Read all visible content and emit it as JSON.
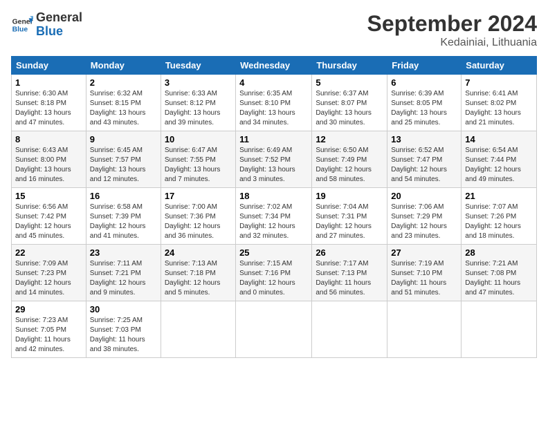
{
  "logo": {
    "line1": "General",
    "line2": "Blue"
  },
  "title": "September 2024",
  "location": "Kedainiai, Lithuania",
  "headers": [
    "Sunday",
    "Monday",
    "Tuesday",
    "Wednesday",
    "Thursday",
    "Friday",
    "Saturday"
  ],
  "weeks": [
    [
      {
        "day": "1",
        "detail": "Sunrise: 6:30 AM\nSunset: 8:18 PM\nDaylight: 13 hours\nand 47 minutes."
      },
      {
        "day": "2",
        "detail": "Sunrise: 6:32 AM\nSunset: 8:15 PM\nDaylight: 13 hours\nand 43 minutes."
      },
      {
        "day": "3",
        "detail": "Sunrise: 6:33 AM\nSunset: 8:12 PM\nDaylight: 13 hours\nand 39 minutes."
      },
      {
        "day": "4",
        "detail": "Sunrise: 6:35 AM\nSunset: 8:10 PM\nDaylight: 13 hours\nand 34 minutes."
      },
      {
        "day": "5",
        "detail": "Sunrise: 6:37 AM\nSunset: 8:07 PM\nDaylight: 13 hours\nand 30 minutes."
      },
      {
        "day": "6",
        "detail": "Sunrise: 6:39 AM\nSunset: 8:05 PM\nDaylight: 13 hours\nand 25 minutes."
      },
      {
        "day": "7",
        "detail": "Sunrise: 6:41 AM\nSunset: 8:02 PM\nDaylight: 13 hours\nand 21 minutes."
      }
    ],
    [
      {
        "day": "8",
        "detail": "Sunrise: 6:43 AM\nSunset: 8:00 PM\nDaylight: 13 hours\nand 16 minutes."
      },
      {
        "day": "9",
        "detail": "Sunrise: 6:45 AM\nSunset: 7:57 PM\nDaylight: 13 hours\nand 12 minutes."
      },
      {
        "day": "10",
        "detail": "Sunrise: 6:47 AM\nSunset: 7:55 PM\nDaylight: 13 hours\nand 7 minutes."
      },
      {
        "day": "11",
        "detail": "Sunrise: 6:49 AM\nSunset: 7:52 PM\nDaylight: 13 hours\nand 3 minutes."
      },
      {
        "day": "12",
        "detail": "Sunrise: 6:50 AM\nSunset: 7:49 PM\nDaylight: 12 hours\nand 58 minutes."
      },
      {
        "day": "13",
        "detail": "Sunrise: 6:52 AM\nSunset: 7:47 PM\nDaylight: 12 hours\nand 54 minutes."
      },
      {
        "day": "14",
        "detail": "Sunrise: 6:54 AM\nSunset: 7:44 PM\nDaylight: 12 hours\nand 49 minutes."
      }
    ],
    [
      {
        "day": "15",
        "detail": "Sunrise: 6:56 AM\nSunset: 7:42 PM\nDaylight: 12 hours\nand 45 minutes."
      },
      {
        "day": "16",
        "detail": "Sunrise: 6:58 AM\nSunset: 7:39 PM\nDaylight: 12 hours\nand 41 minutes."
      },
      {
        "day": "17",
        "detail": "Sunrise: 7:00 AM\nSunset: 7:36 PM\nDaylight: 12 hours\nand 36 minutes."
      },
      {
        "day": "18",
        "detail": "Sunrise: 7:02 AM\nSunset: 7:34 PM\nDaylight: 12 hours\nand 32 minutes."
      },
      {
        "day": "19",
        "detail": "Sunrise: 7:04 AM\nSunset: 7:31 PM\nDaylight: 12 hours\nand 27 minutes."
      },
      {
        "day": "20",
        "detail": "Sunrise: 7:06 AM\nSunset: 7:29 PM\nDaylight: 12 hours\nand 23 minutes."
      },
      {
        "day": "21",
        "detail": "Sunrise: 7:07 AM\nSunset: 7:26 PM\nDaylight: 12 hours\nand 18 minutes."
      }
    ],
    [
      {
        "day": "22",
        "detail": "Sunrise: 7:09 AM\nSunset: 7:23 PM\nDaylight: 12 hours\nand 14 minutes."
      },
      {
        "day": "23",
        "detail": "Sunrise: 7:11 AM\nSunset: 7:21 PM\nDaylight: 12 hours\nand 9 minutes."
      },
      {
        "day": "24",
        "detail": "Sunrise: 7:13 AM\nSunset: 7:18 PM\nDaylight: 12 hours\nand 5 minutes."
      },
      {
        "day": "25",
        "detail": "Sunrise: 7:15 AM\nSunset: 7:16 PM\nDaylight: 12 hours\nand 0 minutes."
      },
      {
        "day": "26",
        "detail": "Sunrise: 7:17 AM\nSunset: 7:13 PM\nDaylight: 11 hours\nand 56 minutes."
      },
      {
        "day": "27",
        "detail": "Sunrise: 7:19 AM\nSunset: 7:10 PM\nDaylight: 11 hours\nand 51 minutes."
      },
      {
        "day": "28",
        "detail": "Sunrise: 7:21 AM\nSunset: 7:08 PM\nDaylight: 11 hours\nand 47 minutes."
      }
    ],
    [
      {
        "day": "29",
        "detail": "Sunrise: 7:23 AM\nSunset: 7:05 PM\nDaylight: 11 hours\nand 42 minutes."
      },
      {
        "day": "30",
        "detail": "Sunrise: 7:25 AM\nSunset: 7:03 PM\nDaylight: 11 hours\nand 38 minutes."
      },
      null,
      null,
      null,
      null,
      null
    ]
  ]
}
